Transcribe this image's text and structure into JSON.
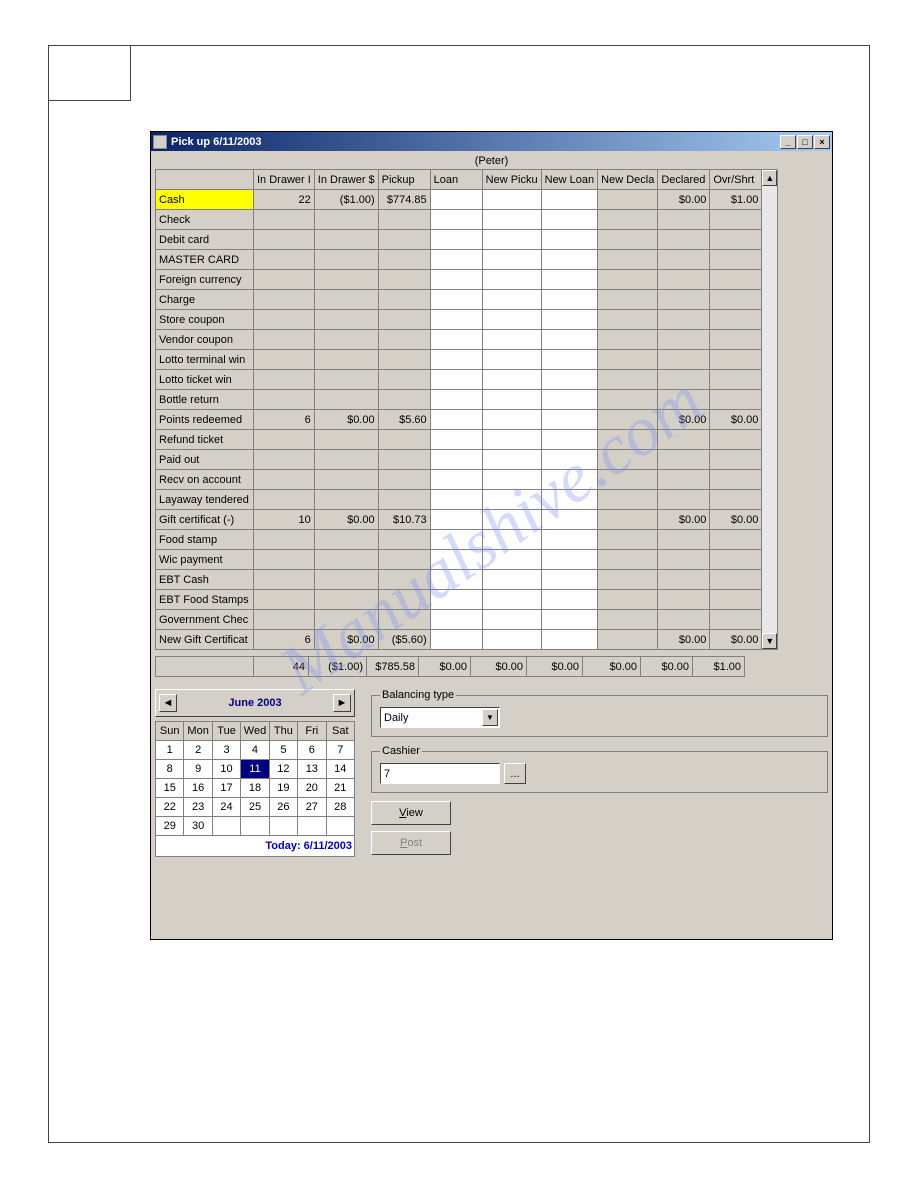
{
  "window": {
    "title": "Pick up  6/11/2003",
    "cashier_name_display": "(Peter)"
  },
  "columns": [
    "",
    "In Drawer I",
    "In Drawer $",
    "Pickup",
    "Loan",
    "New Picku",
    "New Loan",
    "New Decla",
    "Declared",
    "Ovr/Shrt"
  ],
  "rows": [
    {
      "label": "Cash",
      "highlight": true,
      "cells": [
        "22",
        "($1.00)",
        "$774.85",
        "",
        "",
        "",
        "",
        "$0.00",
        "$1.00"
      ]
    },
    {
      "label": "Check",
      "cells": [
        "",
        "",
        "",
        "",
        "",
        "",
        "",
        "",
        ""
      ]
    },
    {
      "label": "Debit card",
      "cells": [
        "",
        "",
        "",
        "",
        "",
        "",
        "",
        "",
        ""
      ]
    },
    {
      "label": "MASTER CARD",
      "cells": [
        "",
        "",
        "",
        "",
        "",
        "",
        "",
        "",
        ""
      ]
    },
    {
      "label": "Foreign currency",
      "cells": [
        "",
        "",
        "",
        "",
        "",
        "",
        "",
        "",
        ""
      ]
    },
    {
      "label": "Charge",
      "cells": [
        "",
        "",
        "",
        "",
        "",
        "",
        "",
        "",
        ""
      ]
    },
    {
      "label": "Store coupon",
      "cells": [
        "",
        "",
        "",
        "",
        "",
        "",
        "",
        "",
        ""
      ]
    },
    {
      "label": "Vendor coupon",
      "cells": [
        "",
        "",
        "",
        "",
        "",
        "",
        "",
        "",
        ""
      ]
    },
    {
      "label": "Lotto terminal win",
      "cells": [
        "",
        "",
        "",
        "",
        "",
        "",
        "",
        "",
        ""
      ]
    },
    {
      "label": "Lotto ticket win",
      "cells": [
        "",
        "",
        "",
        "",
        "",
        "",
        "",
        "",
        ""
      ]
    },
    {
      "label": "Bottle return",
      "cells": [
        "",
        "",
        "",
        "",
        "",
        "",
        "",
        "",
        ""
      ]
    },
    {
      "label": "Points redeemed",
      "cells": [
        "6",
        "$0.00",
        "$5.60",
        "",
        "",
        "",
        "",
        "$0.00",
        "$0.00"
      ]
    },
    {
      "label": "Refund ticket",
      "cells": [
        "",
        "",
        "",
        "",
        "",
        "",
        "",
        "",
        ""
      ]
    },
    {
      "label": "Paid out",
      "cells": [
        "",
        "",
        "",
        "",
        "",
        "",
        "",
        "",
        ""
      ]
    },
    {
      "label": "Recv on account",
      "cells": [
        "",
        "",
        "",
        "",
        "",
        "",
        "",
        "",
        ""
      ]
    },
    {
      "label": "Layaway tendered",
      "cells": [
        "",
        "",
        "",
        "",
        "",
        "",
        "",
        "",
        ""
      ]
    },
    {
      "label": "Gift certificat (-)",
      "cells": [
        "10",
        "$0.00",
        "$10.73",
        "",
        "",
        "",
        "",
        "$0.00",
        "$0.00"
      ]
    },
    {
      "label": "Food stamp",
      "cells": [
        "",
        "",
        "",
        "",
        "",
        "",
        "",
        "",
        ""
      ]
    },
    {
      "label": "Wic payment",
      "cells": [
        "",
        "",
        "",
        "",
        "",
        "",
        "",
        "",
        ""
      ]
    },
    {
      "label": "EBT Cash",
      "cells": [
        "",
        "",
        "",
        "",
        "",
        "",
        "",
        "",
        ""
      ]
    },
    {
      "label": "EBT Food Stamps",
      "cells": [
        "",
        "",
        "",
        "",
        "",
        "",
        "",
        "",
        ""
      ]
    },
    {
      "label": "Government Chec",
      "cells": [
        "",
        "",
        "",
        "",
        "",
        "",
        "",
        "",
        ""
      ]
    },
    {
      "label": "New Gift Certificat",
      "cells": [
        "6",
        "$0.00",
        "($5.60)",
        "",
        "",
        "",
        "",
        "$0.00",
        "$0.00"
      ]
    }
  ],
  "totals": [
    "",
    "44",
    "($1.00)",
    "$785.58",
    "$0.00",
    "$0.00",
    "$0.00",
    "$0.00",
    "$0.00",
    "$1.00"
  ],
  "calendar": {
    "title": "June  2003",
    "dow": [
      "Sun",
      "Mon",
      "Tue",
      "Wed",
      "Thu",
      "Fri",
      "Sat"
    ],
    "weeks": [
      [
        "1",
        "2",
        "3",
        "4",
        "5",
        "6",
        "7"
      ],
      [
        "8",
        "9",
        "10",
        "11",
        "12",
        "13",
        "14"
      ],
      [
        "15",
        "16",
        "17",
        "18",
        "19",
        "20",
        "21"
      ],
      [
        "22",
        "23",
        "24",
        "25",
        "26",
        "27",
        "28"
      ],
      [
        "29",
        "30",
        "",
        "",
        "",
        "",
        ""
      ]
    ],
    "selected": "11",
    "today_label": "Today: 6/11/2003"
  },
  "form": {
    "balancing_legend": "Balancing type",
    "balancing_value": "Daily",
    "cashier_legend": "Cashier",
    "cashier_value": "7",
    "view_label": "View",
    "post_label": "Post",
    "browse_label": "..."
  },
  "watermark": "Manualshive.com",
  "editable_cols": [
    4,
    5,
    6
  ]
}
